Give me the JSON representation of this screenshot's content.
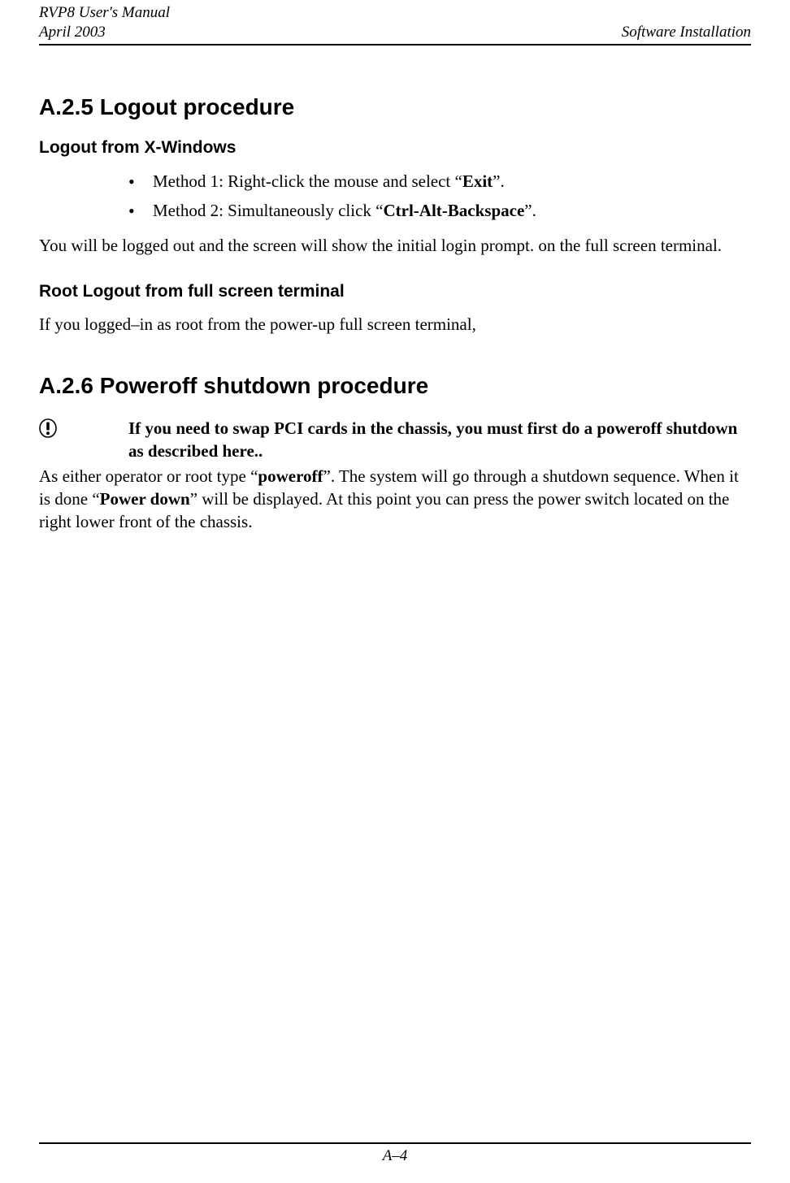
{
  "header": {
    "title_line1": "RVP8 User's Manual",
    "title_line2": "April 2003",
    "right": "Software Installation"
  },
  "sec_a25": {
    "heading": "A.2.5  Logout procedure",
    "sub1": "Logout from X-Windows",
    "m1_pre": "Method 1: Right-click the mouse and select “",
    "m1_bold": "Exit",
    "m1_post": "”.",
    "m2_pre": "Method 2: Simultaneously click “",
    "m2_bold": "Ctrl-Alt-Backspace",
    "m2_post": "”.",
    "para1": "You will be logged out and the screen will show the initial login prompt. on the full screen terminal.",
    "sub2": "Root Logout from full screen terminal",
    "para2": "If you logged–in as root from the power-up full screen terminal,"
  },
  "sec_a26": {
    "heading": "A.2.6  Poweroff shutdown procedure",
    "note": " If you need to swap PCI cards in the chassis, you must first do a poweroff shutdown as described here..",
    "p_pre": "As either operator or root type “",
    "p_b1": "poweroff",
    "p_mid": "”. The system will go through a shutdown sequence. When it is done “",
    "p_b2": "Power down",
    "p_post": "” will be displayed. At this point you can press the power switch located on the right lower front of the chassis."
  },
  "footer": {
    "page": "A–4"
  }
}
